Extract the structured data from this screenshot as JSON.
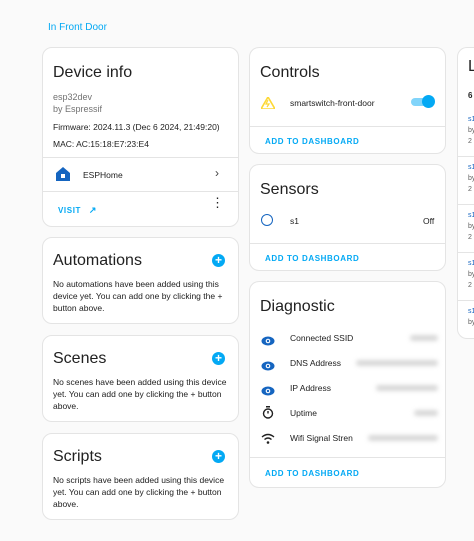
{
  "breadcrumb": "In Front Door",
  "device_info": {
    "title": "Device info",
    "model": "esp32dev",
    "manufacturer": "by Espressif",
    "firmware": "Firmware: 2024.11.3 (Dec 6 2024, 21:49:20)",
    "mac": "MAC: AC:15:18:E7:23:E4",
    "integration": "ESPHome",
    "visit_label": "VISIT"
  },
  "automations": {
    "title": "Automations",
    "description": "No automations have been added using this device yet. You can add one by clicking the + button above."
  },
  "scenes": {
    "title": "Scenes",
    "description": "No scenes have been added using this device yet. You can add one by clicking the + button above."
  },
  "scripts": {
    "title": "Scripts",
    "description": "No scripts have been added using this device yet. You can add one by clicking the + button above."
  },
  "controls": {
    "title": "Controls",
    "items": [
      {
        "label": "smartswitch-front-door",
        "state": "on"
      }
    ],
    "add_label": "ADD TO DASHBOARD"
  },
  "sensors": {
    "title": "Sensors",
    "items": [
      {
        "label": "s1",
        "value": "Off"
      }
    ],
    "add_label": "ADD TO DASHBOARD"
  },
  "diagnostic": {
    "title": "Diagnostic",
    "items": [
      {
        "label": "Connected SSID",
        "icon": "eye-icon"
      },
      {
        "label": "DNS Address",
        "icon": "eye-icon"
      },
      {
        "label": "IP Address",
        "icon": "eye-icon"
      },
      {
        "label": "Uptime",
        "icon": "timer-icon"
      },
      {
        "label": "Wifi Signal Stren",
        "icon": "wifi-icon"
      }
    ],
    "add_label": "ADD TO DASHBOARD"
  },
  "logbook": {
    "title": "L",
    "count": "6",
    "entries": [
      {
        "a": "s1",
        "b": "by",
        "c": "2"
      },
      {
        "a": "s1",
        "b": "by",
        "c": "2"
      },
      {
        "a": "s1",
        "b": "by",
        "c": "2"
      },
      {
        "a": "s1",
        "b": "by",
        "c": "2"
      },
      {
        "a": "s1",
        "b": "by"
      }
    ]
  },
  "colors": {
    "accent": "#03a9f4",
    "icon_blue": "#1565c0",
    "warning": "#fdd835"
  }
}
